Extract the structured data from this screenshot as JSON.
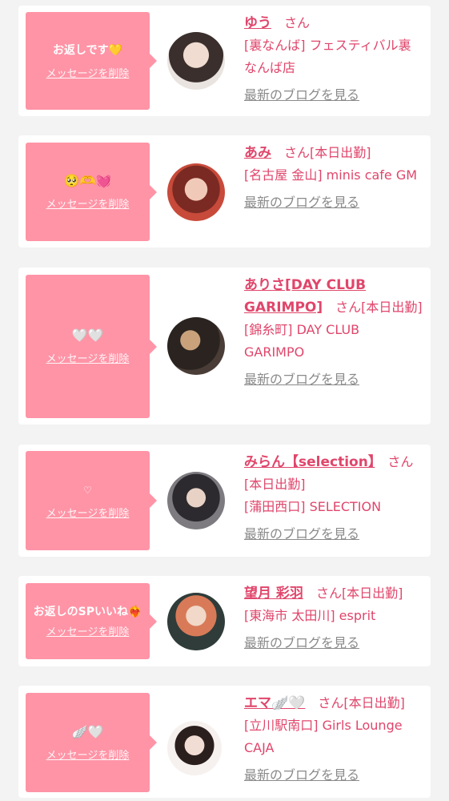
{
  "common": {
    "delete_label": "メッセージを削除",
    "blog_label": "最新のブログを見る"
  },
  "cards": [
    {
      "bubble": "お返しです💛",
      "name": "ゆう",
      "suffix": "さん",
      "shop": "[裏なんば] フェスティバル裏なんば店"
    },
    {
      "bubble": "🥺🫶💓",
      "name": "あみ",
      "suffix": "さん[本日出勤]",
      "shop": "[名古屋 金山] minis cafe GM"
    },
    {
      "bubble": "🤍🤍",
      "name": "ありさ[DAY CLUB GARIMPO]",
      "suffix": "さん[本日出勤]",
      "shop": "[錦糸町] DAY CLUB GARIMPO"
    },
    {
      "bubble": "♡",
      "name": "みらん【selection】",
      "suffix": "さん[本日出勤]",
      "shop": "[蒲田西口] SELECTION"
    },
    {
      "bubble": "お返しのSPいいね❤️‍🔥",
      "name": "望月 彩羽",
      "suffix": "さん[本日出勤]",
      "shop": "[東海市 太田川] esprit"
    },
    {
      "bubble": "🪽🤍",
      "name": "エマ🪽🤍",
      "suffix": "さん[本日出勤]",
      "shop": "[立川駅南口] Girls Lounge CAJA"
    }
  ],
  "colors": {
    "bubble": "#ff94a6",
    "name": "#e0466b",
    "link_gray": "#8a8a8a",
    "page_bg": "#f3f3f3"
  }
}
